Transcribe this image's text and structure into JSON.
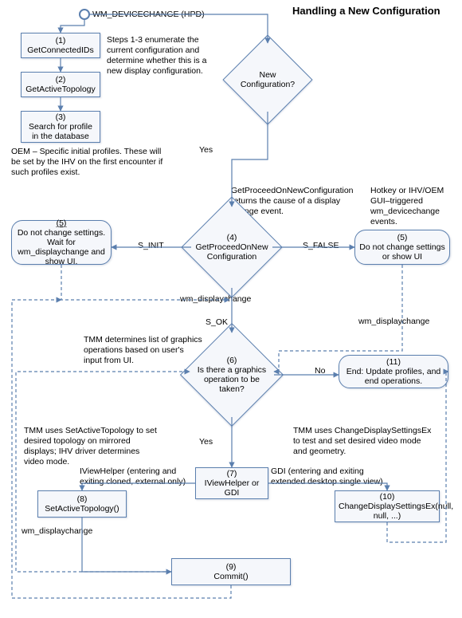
{
  "title": "Handling a New Configuration",
  "start": "WM_DEVICECHANGE (HPD)",
  "nodes": {
    "n1": {
      "num": "(1)",
      "label": "GetConnectedIDs"
    },
    "n2": {
      "num": "(2)",
      "label": "GetActiveTopology"
    },
    "n3": {
      "num": "(3)",
      "label": "Search for profile in the database"
    },
    "d_newcfg": "New Configuration?",
    "n4": {
      "num": "(4)",
      "label": "GetProceedOnNew Configuration"
    },
    "n5l": {
      "num": "(5)",
      "label": "Do not change settings. Wait for wm_displaychange and show UI."
    },
    "n5r": {
      "num": "(5)",
      "label": "Do not change settings or show UI"
    },
    "d6": {
      "num": "(6)",
      "label": "Is there a graphics operation to be taken?"
    },
    "n7": {
      "num": "(7)",
      "label": "IViewHelper or GDI"
    },
    "n8": {
      "num": "(8)",
      "label": "SetActiveTopology()"
    },
    "n9": {
      "num": "(9)",
      "label": "Commit()"
    },
    "n10": {
      "num": "(10)",
      "label": "ChangeDisplaySettingsEx(null, null, ...)"
    },
    "n11": {
      "num": "(11)",
      "label": "End:  Update profiles, and end operations."
    }
  },
  "ann": {
    "a_enum": "Steps 1-3 enumerate the current configuration and determine whether this is a new display configuration.",
    "a_oem": "OEM – Specific initial profiles. These will be set by the IHV on the first encounter if such profiles exist.",
    "a_get": "GetProceedOnNewConfiguration returns the cause of a display change event.",
    "a_hotkey": "Hotkey or IHV/OEM GUI–triggered wm_devicechange events.",
    "a_tmm_ui": "TMM determines list of graphics operations based on user's input from UI.",
    "a_sat": "TMM uses SetActiveTopology to set desired topology on mirrored displays; IHV driver determines video mode.",
    "a_ivh": "IViewHelper (entering and exiting cloned, external only)",
    "a_cds": "TMM uses ChangeDisplaySettingsEx to test and set desired video mode and geometry.",
    "a_gdi": "GDI (entering and exiting extended desktop single view)"
  },
  "edges": {
    "yes1": "Yes",
    "s_init": "S_INIT",
    "s_false": "S_FALSE",
    "s_ok": "S_OK",
    "wm1": "wm_displaychange",
    "wm2": "wm_displaychange",
    "wm3": "wm_displaychange",
    "no": "No",
    "yes2": "Yes"
  }
}
